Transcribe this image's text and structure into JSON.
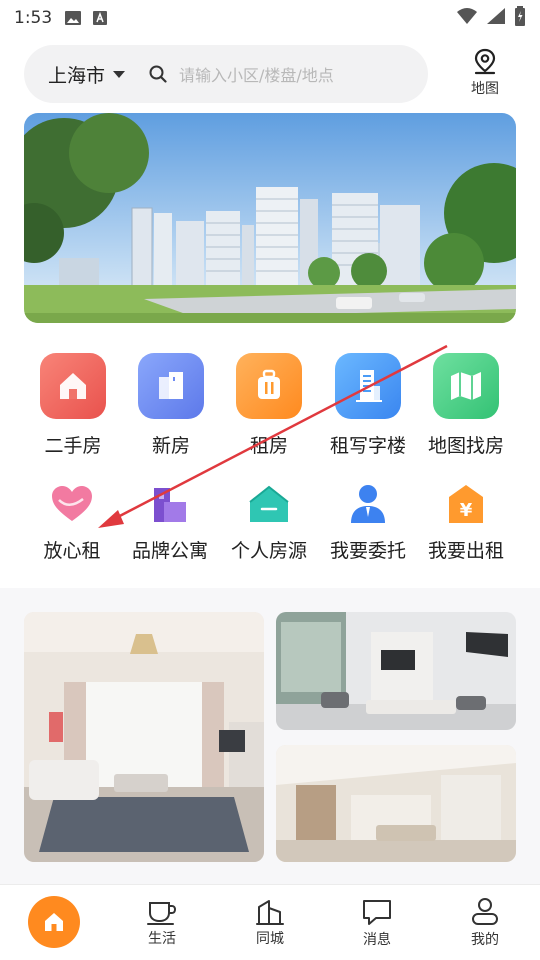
{
  "status_bar": {
    "time": "1:53",
    "icons": [
      "image-icon",
      "a-text-icon",
      "wifi-icon",
      "signal-icon",
      "battery-charging-icon"
    ]
  },
  "top_bar": {
    "city": "上海市",
    "search_placeholder": "请输入小区/楼盘/地点",
    "map_label": "地图"
  },
  "categories_primary": [
    {
      "label": "二手房",
      "icon": "house-icon",
      "color": "#f25f5c"
    },
    {
      "label": "新房",
      "icon": "building-icon",
      "color": "#6f8cf3"
    },
    {
      "label": "租房",
      "icon": "suitcase-icon",
      "color": "#ff9a2e"
    },
    {
      "label": "租写字楼",
      "icon": "office-tower-icon",
      "color": "#4a9cf6"
    },
    {
      "label": "地图找房",
      "icon": "map-icon",
      "color": "#3fcf7f"
    }
  ],
  "categories_secondary": [
    {
      "label": "放心租",
      "icon": "heart-icon",
      "color": "#f06292"
    },
    {
      "label": "品牌公寓",
      "icon": "apartment-icon",
      "color": "#8a5bd6"
    },
    {
      "label": "个人房源",
      "icon": "home-icon",
      "color": "#2fc6b3"
    },
    {
      "label": "我要委托",
      "icon": "agent-icon",
      "color": "#3d82f0"
    },
    {
      "label": "我要出租",
      "icon": "yuan-tag-icon",
      "color": "#ff9a2e"
    }
  ],
  "bottom_nav": {
    "items": [
      {
        "label": "",
        "icon": "home-icon",
        "active": true
      },
      {
        "label": "生活",
        "icon": "coffee-cup-icon"
      },
      {
        "label": "同城",
        "icon": "city-building-icon"
      },
      {
        "label": "消息",
        "icon": "chat-bubble-icon"
      },
      {
        "label": "我的",
        "icon": "person-icon"
      }
    ]
  },
  "colors": {
    "accent": "#ff8a1f",
    "annotation_arrow": "#e0393e"
  }
}
